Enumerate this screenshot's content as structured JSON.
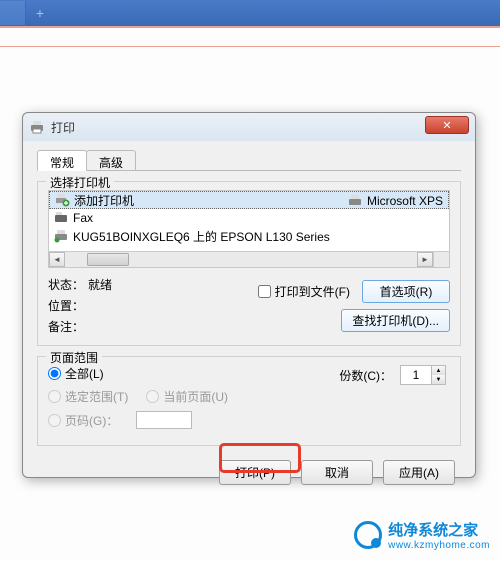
{
  "topbar": {
    "plus": "+"
  },
  "dialog": {
    "title": "打印",
    "close_label": "✕",
    "tabs": {
      "general": "常规",
      "advanced": "高级"
    },
    "select_printer_legend": "选择打印机",
    "printers": {
      "add": "添加打印机",
      "fax": "Fax",
      "epson": "KUG51BOINXGLEQ6 上的 EPSON L130 Series",
      "msxps": "Microsoft XPS"
    },
    "status": {
      "label_status": "状态：",
      "value_status": "就绪",
      "label_location": "位置：",
      "value_location": "",
      "label_comment": "备注：",
      "value_comment": "",
      "print_to_file": "打印到文件(F)",
      "preferences_btn": "首选项(R)",
      "find_printer_btn": "查找打印机(D)..."
    },
    "range": {
      "legend": "页面范围",
      "all": "全部(L)",
      "selection": "选定范围(T)",
      "current": "当前页面(U)",
      "pages": "页码(G)：",
      "copies_label": "份数(C)：",
      "copies_value": "1"
    },
    "buttons": {
      "print": "打印(P)",
      "cancel": "取消",
      "apply": "应用(A)"
    }
  },
  "watermark": {
    "cn": "纯净系统之家",
    "url": "www.kzmyhome.com"
  }
}
